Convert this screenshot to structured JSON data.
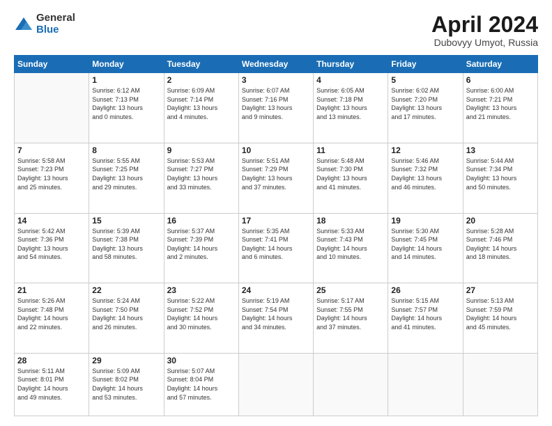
{
  "logo": {
    "general": "General",
    "blue": "Blue"
  },
  "header": {
    "title": "April 2024",
    "subtitle": "Dubovyy Umyot, Russia"
  },
  "days_of_week": [
    "Sunday",
    "Monday",
    "Tuesday",
    "Wednesday",
    "Thursday",
    "Friday",
    "Saturday"
  ],
  "weeks": [
    [
      {
        "day": "",
        "info": ""
      },
      {
        "day": "1",
        "info": "Sunrise: 6:12 AM\nSunset: 7:13 PM\nDaylight: 13 hours\nand 0 minutes."
      },
      {
        "day": "2",
        "info": "Sunrise: 6:09 AM\nSunset: 7:14 PM\nDaylight: 13 hours\nand 4 minutes."
      },
      {
        "day": "3",
        "info": "Sunrise: 6:07 AM\nSunset: 7:16 PM\nDaylight: 13 hours\nand 9 minutes."
      },
      {
        "day": "4",
        "info": "Sunrise: 6:05 AM\nSunset: 7:18 PM\nDaylight: 13 hours\nand 13 minutes."
      },
      {
        "day": "5",
        "info": "Sunrise: 6:02 AM\nSunset: 7:20 PM\nDaylight: 13 hours\nand 17 minutes."
      },
      {
        "day": "6",
        "info": "Sunrise: 6:00 AM\nSunset: 7:21 PM\nDaylight: 13 hours\nand 21 minutes."
      }
    ],
    [
      {
        "day": "7",
        "info": "Sunrise: 5:58 AM\nSunset: 7:23 PM\nDaylight: 13 hours\nand 25 minutes."
      },
      {
        "day": "8",
        "info": "Sunrise: 5:55 AM\nSunset: 7:25 PM\nDaylight: 13 hours\nand 29 minutes."
      },
      {
        "day": "9",
        "info": "Sunrise: 5:53 AM\nSunset: 7:27 PM\nDaylight: 13 hours\nand 33 minutes."
      },
      {
        "day": "10",
        "info": "Sunrise: 5:51 AM\nSunset: 7:29 PM\nDaylight: 13 hours\nand 37 minutes."
      },
      {
        "day": "11",
        "info": "Sunrise: 5:48 AM\nSunset: 7:30 PM\nDaylight: 13 hours\nand 41 minutes."
      },
      {
        "day": "12",
        "info": "Sunrise: 5:46 AM\nSunset: 7:32 PM\nDaylight: 13 hours\nand 46 minutes."
      },
      {
        "day": "13",
        "info": "Sunrise: 5:44 AM\nSunset: 7:34 PM\nDaylight: 13 hours\nand 50 minutes."
      }
    ],
    [
      {
        "day": "14",
        "info": "Sunrise: 5:42 AM\nSunset: 7:36 PM\nDaylight: 13 hours\nand 54 minutes."
      },
      {
        "day": "15",
        "info": "Sunrise: 5:39 AM\nSunset: 7:38 PM\nDaylight: 13 hours\nand 58 minutes."
      },
      {
        "day": "16",
        "info": "Sunrise: 5:37 AM\nSunset: 7:39 PM\nDaylight: 14 hours\nand 2 minutes."
      },
      {
        "day": "17",
        "info": "Sunrise: 5:35 AM\nSunset: 7:41 PM\nDaylight: 14 hours\nand 6 minutes."
      },
      {
        "day": "18",
        "info": "Sunrise: 5:33 AM\nSunset: 7:43 PM\nDaylight: 14 hours\nand 10 minutes."
      },
      {
        "day": "19",
        "info": "Sunrise: 5:30 AM\nSunset: 7:45 PM\nDaylight: 14 hours\nand 14 minutes."
      },
      {
        "day": "20",
        "info": "Sunrise: 5:28 AM\nSunset: 7:46 PM\nDaylight: 14 hours\nand 18 minutes."
      }
    ],
    [
      {
        "day": "21",
        "info": "Sunrise: 5:26 AM\nSunset: 7:48 PM\nDaylight: 14 hours\nand 22 minutes."
      },
      {
        "day": "22",
        "info": "Sunrise: 5:24 AM\nSunset: 7:50 PM\nDaylight: 14 hours\nand 26 minutes."
      },
      {
        "day": "23",
        "info": "Sunrise: 5:22 AM\nSunset: 7:52 PM\nDaylight: 14 hours\nand 30 minutes."
      },
      {
        "day": "24",
        "info": "Sunrise: 5:19 AM\nSunset: 7:54 PM\nDaylight: 14 hours\nand 34 minutes."
      },
      {
        "day": "25",
        "info": "Sunrise: 5:17 AM\nSunset: 7:55 PM\nDaylight: 14 hours\nand 37 minutes."
      },
      {
        "day": "26",
        "info": "Sunrise: 5:15 AM\nSunset: 7:57 PM\nDaylight: 14 hours\nand 41 minutes."
      },
      {
        "day": "27",
        "info": "Sunrise: 5:13 AM\nSunset: 7:59 PM\nDaylight: 14 hours\nand 45 minutes."
      }
    ],
    [
      {
        "day": "28",
        "info": "Sunrise: 5:11 AM\nSunset: 8:01 PM\nDaylight: 14 hours\nand 49 minutes."
      },
      {
        "day": "29",
        "info": "Sunrise: 5:09 AM\nSunset: 8:02 PM\nDaylight: 14 hours\nand 53 minutes."
      },
      {
        "day": "30",
        "info": "Sunrise: 5:07 AM\nSunset: 8:04 PM\nDaylight: 14 hours\nand 57 minutes."
      },
      {
        "day": "",
        "info": ""
      },
      {
        "day": "",
        "info": ""
      },
      {
        "day": "",
        "info": ""
      },
      {
        "day": "",
        "info": ""
      }
    ]
  ]
}
